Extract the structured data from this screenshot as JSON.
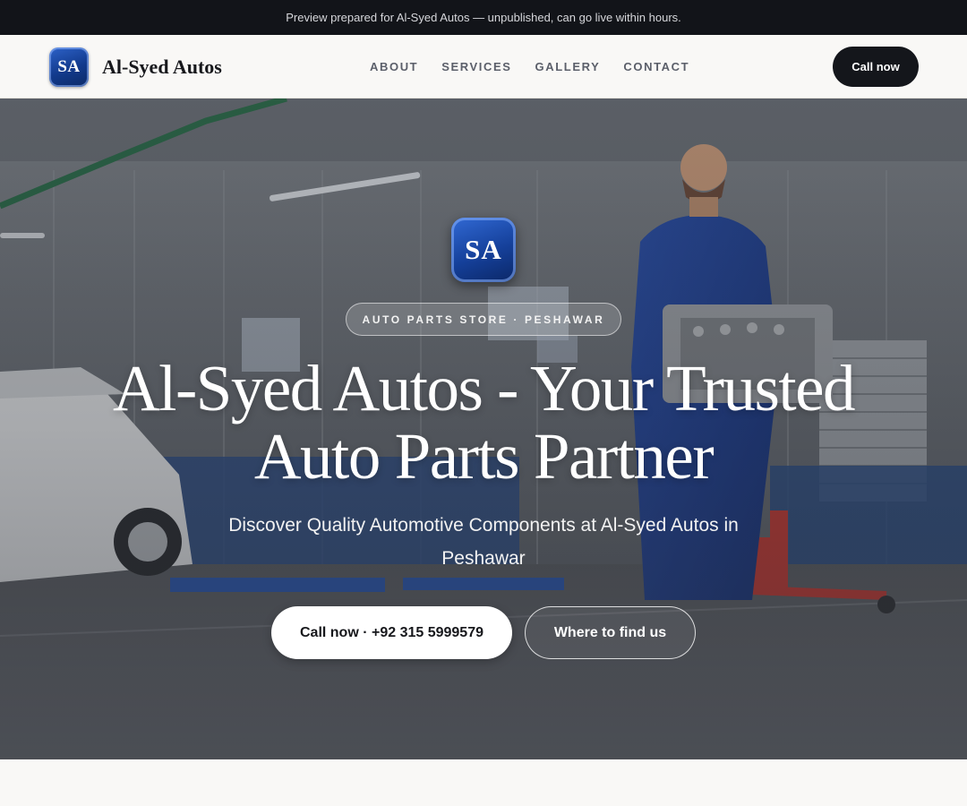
{
  "preview_banner": {
    "text": "Preview prepared for Al-Syed Autos — unpublished, can go live within hours."
  },
  "header": {
    "logo_initials": "SA",
    "brand_name": "Al-Syed Autos",
    "nav": [
      "ABOUT",
      "SERVICES",
      "GALLERY",
      "CONTACT"
    ],
    "cta_label": "Call now"
  },
  "hero": {
    "logo_initials": "SA",
    "eyebrow": "AUTO PARTS STORE · PESHAWAR",
    "title": "Al-Syed Autos - Your Trusted Auto Parts Partner",
    "subtitle": "Discover Quality Automotive Components at Al-Syed Autos in Peshawar",
    "primary_button": "Call now · +92 315 5999579",
    "secondary_button": "Where to find us",
    "background_image": "mechanic-workshop-photo"
  },
  "colors": {
    "banner_bg": "#121419",
    "page_bg": "#f9f8f6",
    "dark_button": "#14161b",
    "logo_blue": "#15409a"
  }
}
